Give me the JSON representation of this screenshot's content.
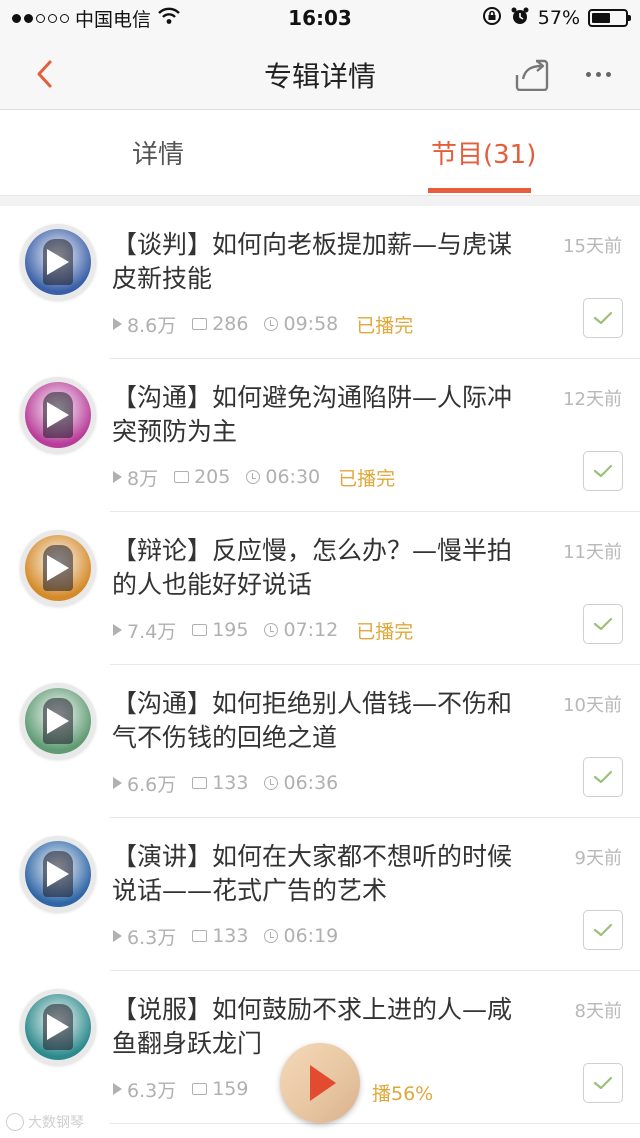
{
  "status_bar": {
    "carrier": "中国电信",
    "time": "16:03",
    "battery_percent": "57%",
    "battery_level": 0.57,
    "signal_bars_filled": 2,
    "signal_bars_total": 5
  },
  "nav": {
    "title": "专辑详情",
    "back_icon": "chevron-left-icon",
    "share_icon": "share-icon",
    "more_icon": "more-dots-icon"
  },
  "tabs": [
    {
      "label": "详情",
      "active": false
    },
    {
      "label": "节目(31)",
      "active": true
    }
  ],
  "colors": {
    "accent": "#e55d3a",
    "played": "#e0a73a",
    "muted": "#b0b0b0"
  },
  "episodes": [
    {
      "title": "【谈判】如何向老板提加薪—与虎谋皮新技能",
      "ago": "15天前",
      "plays": "8.6万",
      "comments": "286",
      "duration": "09:58",
      "status": "已播完",
      "cover_color": "#3a5fa8"
    },
    {
      "title": "【沟通】如何避免沟通陷阱—人际冲突预防为主",
      "ago": "12天前",
      "plays": "8万",
      "comments": "205",
      "duration": "06:30",
      "status": "已播完",
      "cover_color": "#b83d9a"
    },
    {
      "title": "【辩论】反应慢，怎么办？—慢半拍的人也能好好说话",
      "ago": "11天前",
      "plays": "7.4万",
      "comments": "195",
      "duration": "07:12",
      "status": "已播完",
      "cover_color": "#d58a2a"
    },
    {
      "title": "【沟通】如何拒绝别人借钱—不伤和气不伤钱的回绝之道",
      "ago": "10天前",
      "plays": "6.6万",
      "comments": "133",
      "duration": "06:36",
      "status": "",
      "cover_color": "#5f9b73"
    },
    {
      "title": "【演讲】如何在大家都不想听的时候说话——花式广告的艺术",
      "ago": "9天前",
      "plays": "6.3万",
      "comments": "133",
      "duration": "06:19",
      "status": "",
      "cover_color": "#2f66a6"
    },
    {
      "title": "【说服】如何鼓励不求上进的人—咸鱼翻身跃龙门",
      "ago": "8天前",
      "plays": "6.3万",
      "comments": "159",
      "duration": "",
      "status": "",
      "cover_color": "#2d8a8c"
    }
  ],
  "player": {
    "progress_text": "播56%",
    "progress": 0.56
  },
  "watermark": "大数钢琴"
}
